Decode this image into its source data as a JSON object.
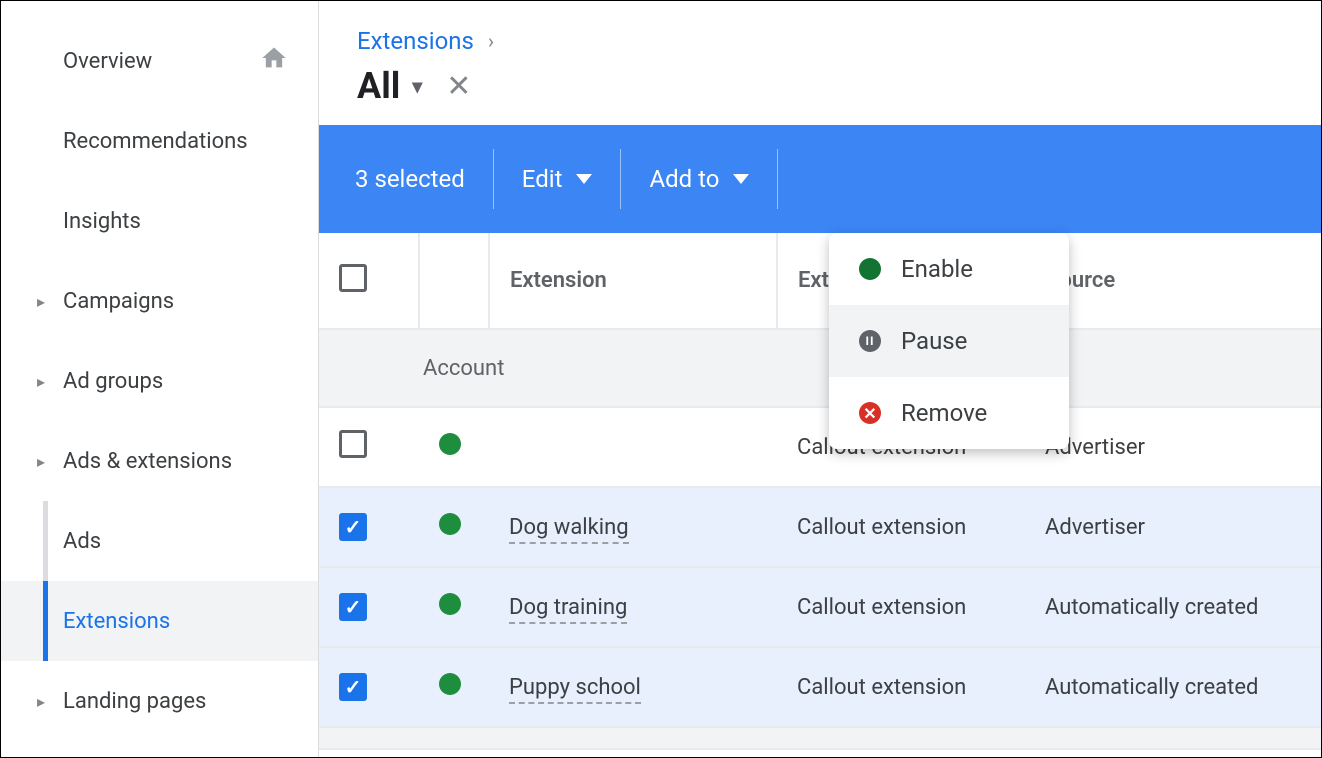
{
  "sidebar": {
    "items": [
      {
        "label": "Overview",
        "expandable": false,
        "home": true
      },
      {
        "label": "Recommendations",
        "expandable": false
      },
      {
        "label": "Insights",
        "expandable": false
      },
      {
        "label": "Campaigns",
        "expandable": true
      },
      {
        "label": "Ad groups",
        "expandable": true
      },
      {
        "label": "Ads & extensions",
        "expandable": true,
        "expanded": true,
        "children": [
          {
            "label": "Ads"
          },
          {
            "label": "Extensions",
            "active": true
          }
        ]
      },
      {
        "label": "Landing pages",
        "expandable": true
      }
    ]
  },
  "header": {
    "breadcrumb": "Extensions",
    "title": "All"
  },
  "actionbar": {
    "selected_text": "3 selected",
    "edit": "Edit",
    "addto": "Add to"
  },
  "menu": {
    "enable": "Enable",
    "pause": "Pause",
    "remove": "Remove"
  },
  "table": {
    "columns": {
      "ext": "Extension",
      "type": "Extension type",
      "source": "Source"
    },
    "group_label": "Account",
    "rows": [
      {
        "checked": false,
        "name": "",
        "type": "Callout extension",
        "source": "Advertiser"
      },
      {
        "checked": true,
        "name": "Dog walking",
        "type": "Callout extension",
        "source": "Advertiser"
      },
      {
        "checked": true,
        "name": "Dog training",
        "type": "Callout extension",
        "source": "Automatically created"
      },
      {
        "checked": true,
        "name": "Puppy school",
        "type": "Callout extension",
        "source": "Automatically created"
      }
    ]
  }
}
